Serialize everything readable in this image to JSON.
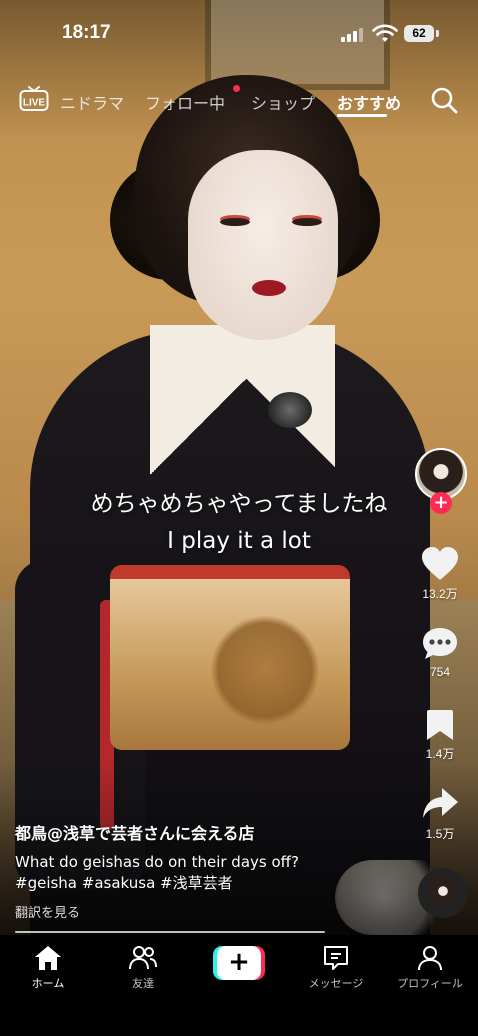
{
  "status_bar": {
    "time": "18:17",
    "battery": "62"
  },
  "top_nav": {
    "live_label": "LIVE",
    "tabs": [
      {
        "label": "ニドラマ",
        "active": false
      },
      {
        "label": "フォロー中",
        "active": false
      },
      {
        "label": "ショップ",
        "active": false
      },
      {
        "label": "おすすめ",
        "active": true
      }
    ]
  },
  "captions": {
    "japanese": "めちゃめちゃやってましたね",
    "english": "I play it a lot"
  },
  "right_rail": {
    "likes": "13.2万",
    "comments": "754",
    "saves": "1.4万",
    "shares": "1.5万"
  },
  "video_info": {
    "author": "都鳥@浅草で芸者さんに会える店",
    "description": "What do geishas do on their days off?",
    "hashtags": "#geisha #asakusa #浅草芸者",
    "translate": "翻訳を見る"
  },
  "bottom_tabs": [
    {
      "label": "ホーム",
      "icon": "home-icon",
      "active": true
    },
    {
      "label": "友達",
      "icon": "friends-icon",
      "active": false
    },
    {
      "label": "メッセージ",
      "icon": "message-icon",
      "active": false
    },
    {
      "label": "プロフィール",
      "icon": "profile-icon",
      "active": false
    }
  ],
  "colors": {
    "accent_red": "#fe2c55",
    "accent_cyan": "#25f4ee",
    "tabbar_bg": "#000000"
  },
  "playback_progress": 0.68
}
